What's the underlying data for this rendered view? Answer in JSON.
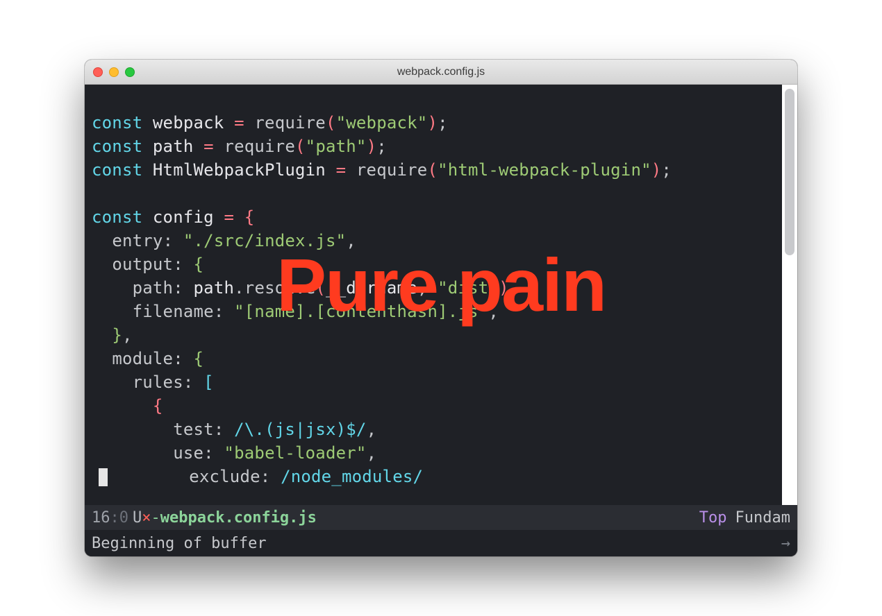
{
  "window": {
    "title": "webpack.config.js"
  },
  "overlay": {
    "text": "Pure pain"
  },
  "code": {
    "l1": {
      "kw": "const",
      "var": "webpack",
      "eq": " = ",
      "fn": "require",
      "lp": "(",
      "str": "\"webpack\"",
      "rp": ")",
      "semi": ";"
    },
    "l2": {
      "kw": "const",
      "var": "path",
      "eq": " = ",
      "fn": "require",
      "lp": "(",
      "str": "\"path\"",
      "rp": ")",
      "semi": ";"
    },
    "l3": {
      "kw": "const",
      "var": "HtmlWebpackPlugin",
      "eq": " = ",
      "fn": "require",
      "lp": "(",
      "str": "\"html-webpack-plugin\"",
      "rp": ")",
      "semi": ";"
    },
    "l4": "",
    "l5": {
      "kw": "const",
      "var": "config",
      "eq": " = ",
      "brace": "{"
    },
    "l6": {
      "indent": "  ",
      "prop": "entry",
      "colon": ": ",
      "str": "\"./src/index.js\"",
      "comma": ","
    },
    "l7": {
      "indent": "  ",
      "prop": "output",
      "colon": ": ",
      "brace": "{"
    },
    "l8": {
      "indent": "    ",
      "prop": "path",
      "colon": ": ",
      "obj": "path",
      "dot": ".",
      "fn": "resolve",
      "lp": "(",
      "arg1": "__dirname",
      "comma1": ", ",
      "str": "\"dist\"",
      "rp": ")",
      "comma": ","
    },
    "l9": {
      "indent": "    ",
      "prop": "filename",
      "colon": ": ",
      "str": "\"[name].[contenthash].js\"",
      "comma": ","
    },
    "l10": {
      "indent": "  ",
      "brace": "}",
      "comma": ","
    },
    "l11": {
      "indent": "  ",
      "prop": "module",
      "colon": ": ",
      "brace": "{"
    },
    "l12": {
      "indent": "    ",
      "prop": "rules",
      "colon": ": ",
      "bracket": "["
    },
    "l13": {
      "indent": "      ",
      "brace": "{"
    },
    "l14": {
      "indent": "        ",
      "prop": "test",
      "colon": ": ",
      "rgx": "/\\.(js|jsx)$/",
      "comma": ","
    },
    "l15": {
      "indent": "        ",
      "prop": "use",
      "colon": ": ",
      "str": "\"babel-loader\"",
      "comma": ","
    },
    "l16": {
      "indent": "        ",
      "prop": "exclude",
      "colon": ": ",
      "rgx": "/node_modules/"
    }
  },
  "modeline": {
    "line": "16",
    "sep": ":",
    "col": " 0",
    "u": " U",
    "x": "×",
    "dash": "-",
    "filename": "webpack.config.js",
    "top": "Top",
    "mode": "Fundam"
  },
  "minibuffer": {
    "text": "Beginning of buffer",
    "arrow": "→"
  }
}
